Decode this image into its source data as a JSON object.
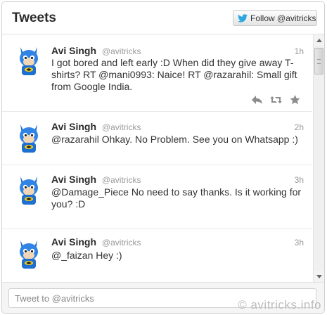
{
  "header": {
    "title": "Tweets",
    "follow_label": "Follow @avitricks"
  },
  "tweets": [
    {
      "name": "Avi Singh",
      "handle": "@avitricks",
      "time": "1h",
      "text_parts": [
        "I got bored and left early :D When did they give away T-shirts? RT ",
        "@mani0993",
        ": Naice! RT ",
        "@razarahil",
        ": Small gift from Google India."
      ],
      "actions": [
        "reply-icon",
        "retweet-icon",
        "favorite-icon"
      ]
    },
    {
      "name": "Avi Singh",
      "handle": "@avitricks",
      "time": "2h",
      "text_parts": [
        "@razarahil",
        " Ohkay. No Problem. See you on Whatsapp :)"
      ]
    },
    {
      "name": "Avi Singh",
      "handle": "@avitricks",
      "time": "3h",
      "text_parts": [
        "@Damage_Piece",
        " No need to say thanks. Is it working for you? :D"
      ]
    },
    {
      "name": "Avi Singh",
      "handle": "@avitricks",
      "time": "3h",
      "text_parts": [
        "@_faizan",
        " Hey :)"
      ]
    }
  ],
  "compose": {
    "placeholder": "Tweet to @avitricks"
  },
  "watermark": "© avitricks.info",
  "colors": {
    "twitter_blue": "#2ea7e0",
    "avatar_blue": "#1e6fd0",
    "text": "#333333",
    "muted": "#999999"
  }
}
